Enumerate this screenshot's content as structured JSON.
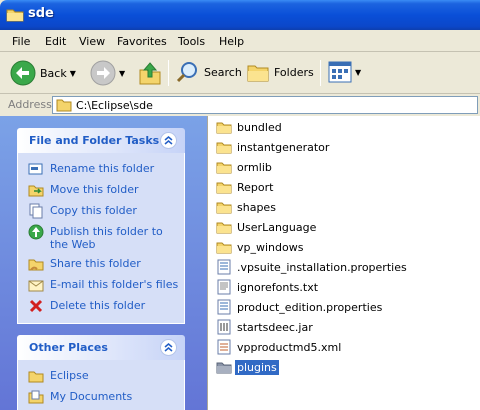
{
  "window": {
    "title": "sde"
  },
  "menu": [
    "File",
    "Edit",
    "View",
    "Favorites",
    "Tools",
    "Help"
  ],
  "toolbar": {
    "back_label": "Back",
    "search_label": "Search",
    "folders_label": "Folders"
  },
  "address": {
    "label": "Address",
    "path": "C:\\Eclipse\\sde"
  },
  "tasks_panel": {
    "title": "File and Folder Tasks",
    "items": [
      {
        "label": "Rename this folder",
        "icon": "rename-icon"
      },
      {
        "label": "Move this folder",
        "icon": "move-icon"
      },
      {
        "label": "Copy this folder",
        "icon": "copy-icon"
      },
      {
        "label": "Publish this folder to the Web",
        "icon": "publish-web-icon"
      },
      {
        "label": "Share this folder",
        "icon": "share-icon"
      },
      {
        "label": "E-mail this folder's files",
        "icon": "email-icon"
      },
      {
        "label": "Delete this folder",
        "icon": "delete-icon"
      }
    ]
  },
  "other_panel": {
    "title": "Other Places",
    "items": [
      {
        "label": "Eclipse",
        "icon": "folder-icon"
      },
      {
        "label": "My Documents",
        "icon": "my-documents-icon"
      }
    ]
  },
  "files": [
    {
      "name": "bundled",
      "type": "folder"
    },
    {
      "name": "instantgenerator",
      "type": "folder"
    },
    {
      "name": "ormlib",
      "type": "folder"
    },
    {
      "name": "Report",
      "type": "folder"
    },
    {
      "name": "shapes",
      "type": "folder"
    },
    {
      "name": "UserLanguage",
      "type": "folder"
    },
    {
      "name": "vp_windows",
      "type": "folder"
    },
    {
      "name": ".vpsuite_installation.properties",
      "type": "properties"
    },
    {
      "name": "ignorefonts.txt",
      "type": "text"
    },
    {
      "name": "product_edition.properties",
      "type": "properties"
    },
    {
      "name": "startsdeec.jar",
      "type": "jar"
    },
    {
      "name": "vpproductmd5.xml",
      "type": "xml"
    },
    {
      "name": "plugins",
      "type": "folder-selected"
    }
  ],
  "colors": {
    "title_blue": "#0a4fd8",
    "link_blue": "#215dc6",
    "selection": "#316ac5"
  }
}
